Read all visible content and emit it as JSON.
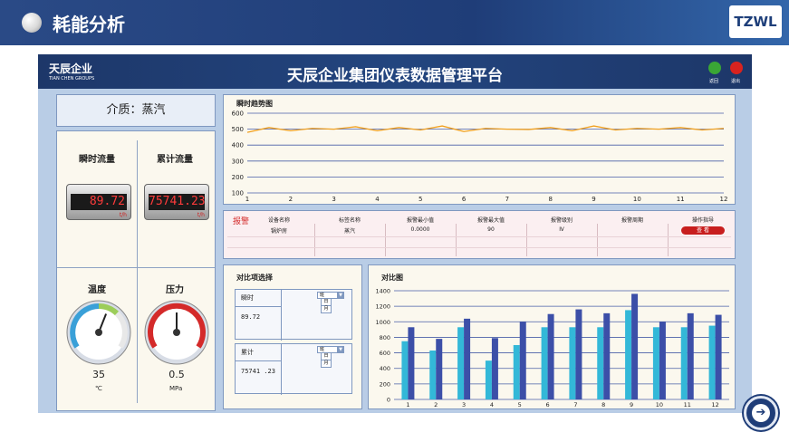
{
  "slide": {
    "title": "耗能分析",
    "logo_text": "TZWL",
    "nav_icon": "arrow-right-icon"
  },
  "app": {
    "brand": "天辰企业",
    "brand_en": "TIAN CHEN GROUPS",
    "title": "天辰企业集团仪表数据管理平台",
    "back_label": "返回",
    "exit_label": "退出"
  },
  "medium": {
    "label": "介质：蒸汽"
  },
  "gauges": {
    "flow_instant_label": "瞬时流量",
    "flow_instant_value": "89.72",
    "flow_unit": "t/h",
    "flow_total_label": "累计流量",
    "flow_total_value": "75741.23",
    "flow_total_unit": "t/h",
    "temp_label": "温度",
    "temp_value": "35",
    "temp_unit": "℃",
    "temp_level": 0.58,
    "press_label": "压力",
    "press_value": "0.5",
    "press_unit": "MPa",
    "press_level": 0.5
  },
  "alarm": {
    "tag": "报警",
    "columns": [
      "设备名称",
      "标签名称",
      "报警最小值",
      "报警最大值",
      "报警级别",
      "报警周期",
      "操作指导"
    ],
    "row": [
      "锅炉房",
      "蒸汽",
      "0.0000",
      "90",
      "Ⅳ",
      ""
    ],
    "view_label": "查 看"
  },
  "compare": {
    "title": "对比项选择",
    "instant_label": "瞬时",
    "instant_value": "89.72",
    "total_label": "累计",
    "total_value": "75741 .23",
    "options": [
      "班",
      "日",
      "月"
    ]
  },
  "colors": {
    "trend_line": "#f0a020",
    "bar_light": "#33b8d8",
    "bar_dark": "#3c4fa8",
    "header": "#1d3769"
  },
  "chart_data": [
    {
      "type": "line",
      "title": "瞬时趋势图",
      "x": [
        1,
        1.5,
        2,
        2.5,
        3,
        3.5,
        4,
        4.5,
        5,
        5.5,
        6,
        6.5,
        7,
        7.5,
        8,
        8.5,
        9,
        9.5,
        10,
        10.5,
        11,
        11.5,
        12
      ],
      "values": [
        480,
        510,
        490,
        505,
        500,
        515,
        490,
        510,
        495,
        520,
        485,
        505,
        500,
        498,
        510,
        490,
        520,
        495,
        505,
        500,
        510,
        495,
        505
      ],
      "xticks": [
        1,
        2,
        3,
        4,
        5,
        6,
        7,
        8,
        9,
        10,
        11,
        12
      ],
      "ylim": [
        100,
        600
      ],
      "yticks": [
        100,
        200,
        300,
        400,
        500,
        600
      ],
      "grid": true
    },
    {
      "type": "bar",
      "title": "对比图",
      "categories": [
        "1",
        "2",
        "3",
        "4",
        "5",
        "6",
        "7",
        "8",
        "9",
        "10",
        "11",
        "12"
      ],
      "series": [
        {
          "values": [
            750,
            630,
            930,
            500,
            700,
            930,
            930,
            930,
            1150,
            930,
            930,
            950
          ]
        },
        {
          "values": [
            930,
            780,
            1040,
            790,
            1000,
            1100,
            1160,
            1110,
            1360,
            1000,
            1110,
            1090
          ]
        }
      ],
      "ylim": [
        0,
        1400
      ],
      "yticks": [
        0,
        200,
        400,
        600,
        800,
        1000,
        1200,
        1400
      ],
      "grid": true
    }
  ]
}
